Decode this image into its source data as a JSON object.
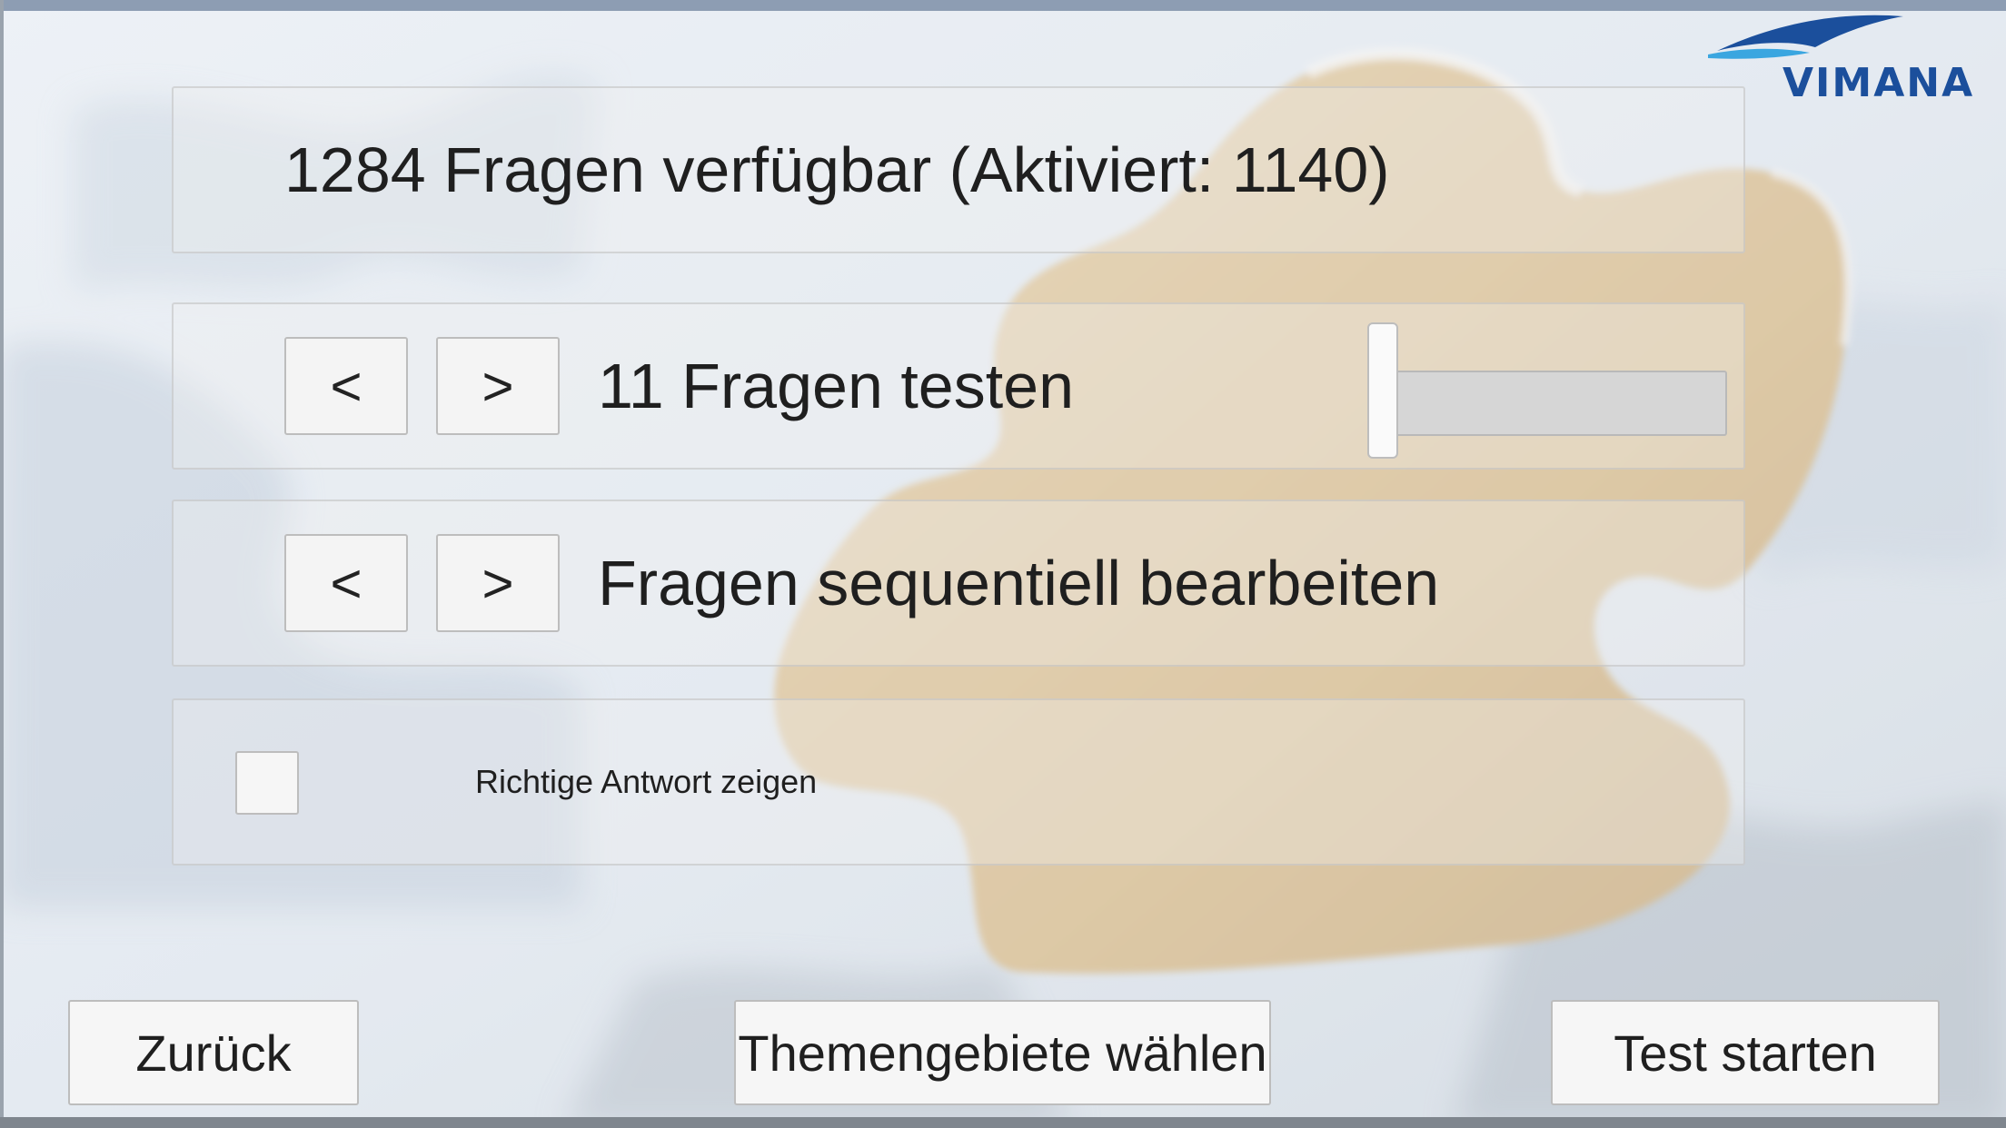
{
  "stats": {
    "available_text": "1284 Fragen verfügbar (Aktiviert: 1140)"
  },
  "question_count": {
    "prev_label": "<",
    "next_label": ">",
    "text": "11 Fragen testen",
    "slider_fraction": 0.0
  },
  "mode": {
    "prev_label": "<",
    "next_label": ">",
    "text": "Fragen sequentiell bearbeiten"
  },
  "show_answer": {
    "checked": false,
    "label": "Richtige Antwort zeigen"
  },
  "footer": {
    "back_label": "Zurück",
    "topics_label": "Themengebiete wählen",
    "start_label": "Test starten"
  },
  "logo": {
    "text": "VIMANA",
    "color": "#1b4f9c"
  },
  "colors": {
    "puzzle_piece": "#d8c09a",
    "background": "#dfe6ee"
  }
}
